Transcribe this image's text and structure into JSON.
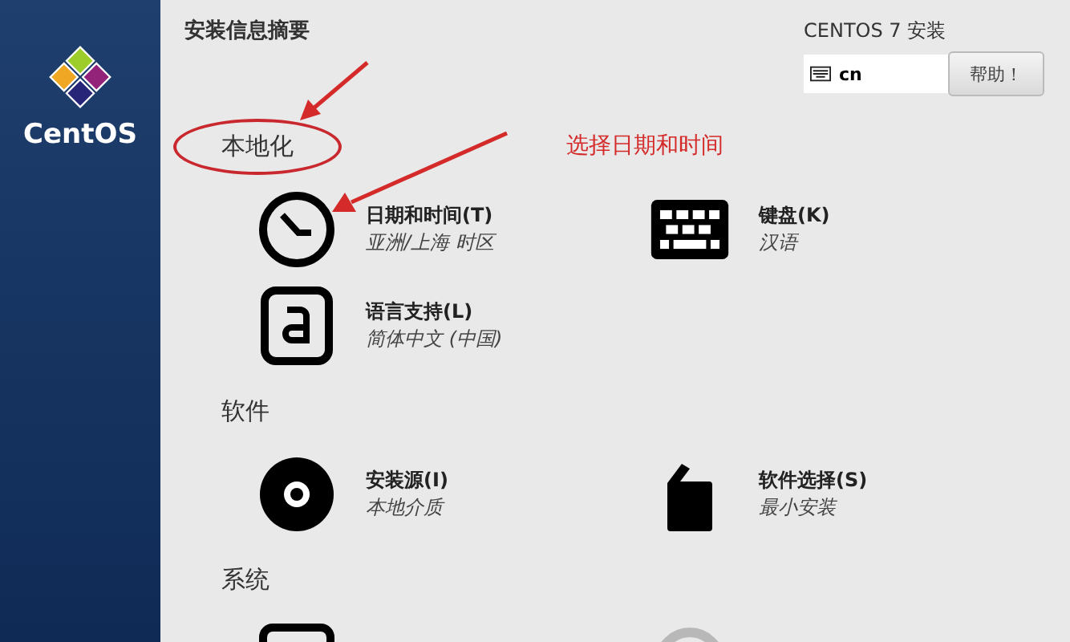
{
  "sidebar": {
    "logo_text": "CentOS"
  },
  "header": {
    "title": "安装信息摘要",
    "product": "CENTOS 7 安装",
    "keyboard_layout": "cn",
    "help_button": "帮助！"
  },
  "sections": [
    {
      "title": "本地化",
      "highlighted": true,
      "items": [
        {
          "kind": "clock",
          "title": "日期和时间(T)",
          "status": "亚洲/上海 时区"
        },
        {
          "kind": "keyboard",
          "title": "键盘(K)",
          "status": "汉语"
        },
        {
          "kind": "language",
          "title": "语言支持(L)",
          "status": "简体中文 (中国)"
        }
      ]
    },
    {
      "title": "软件",
      "highlighted": false,
      "items": [
        {
          "kind": "disc",
          "title": "安装源(I)",
          "status": "本地介质"
        },
        {
          "kind": "package",
          "title": "软件选择(S)",
          "status": "最小安装"
        }
      ]
    },
    {
      "title": "系统",
      "highlighted": false,
      "items": [
        {
          "kind": "drive"
        },
        {
          "kind": "kdump"
        }
      ]
    }
  ],
  "annotation": {
    "text": "选择日期和时间"
  }
}
